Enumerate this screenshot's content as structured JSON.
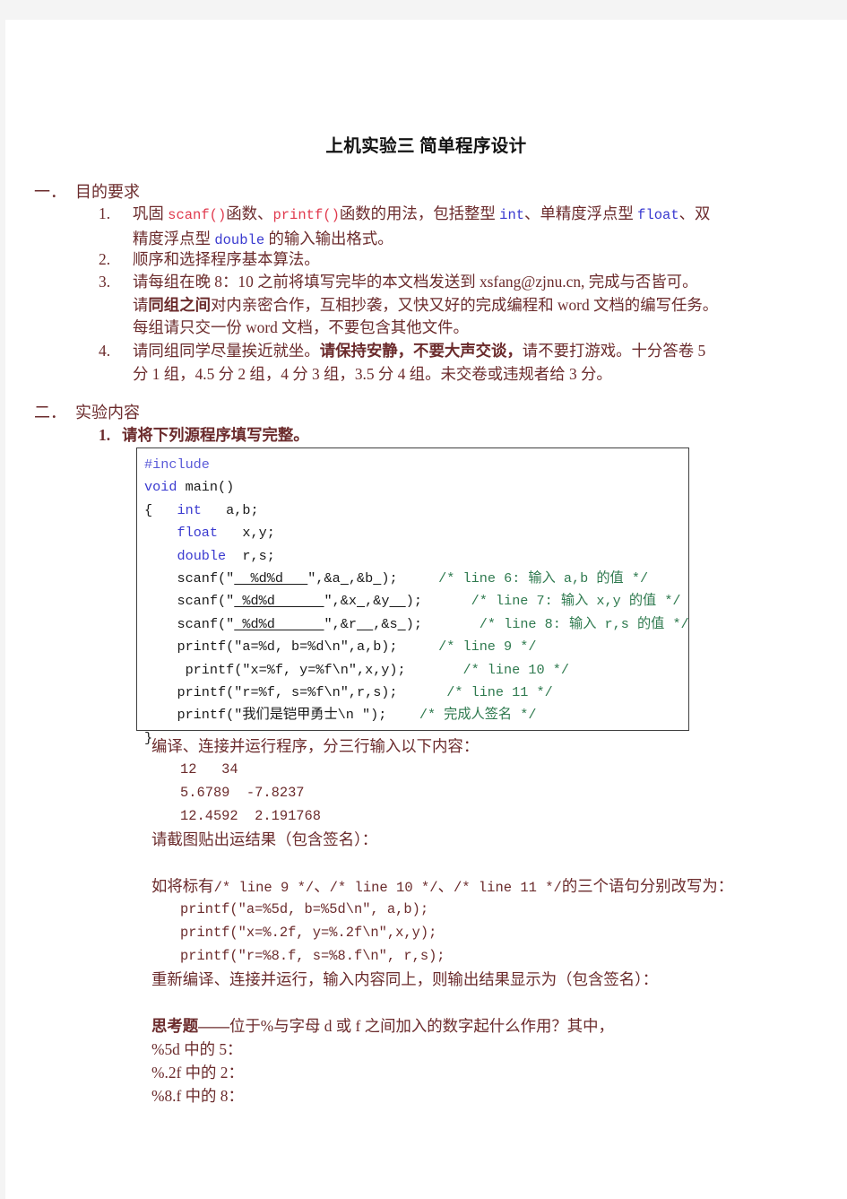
{
  "document": {
    "title": "上机实验三  简单程序设计",
    "colors": {
      "body_text": "#6b2b2c",
      "keyword_blue": "#3a3ad0",
      "function_red": "#e03a4e",
      "comment_green": "#2f7a4f",
      "title_black": "#121212",
      "code_border": "#3f3f3f",
      "page_background": "#f4f4f4"
    }
  },
  "section1": {
    "number": "一．",
    "heading": "目的要求",
    "items": [
      {
        "marker": "1.",
        "line1_a": "巩固 ",
        "line1_scanf": "scanf()",
        "line1_b": "函数、",
        "line1_printf": "printf()",
        "line1_c": "函数的用法，包括整型 ",
        "line1_int": "int",
        "line1_d": "、单精度浮点型 ",
        "line1_float": "float",
        "line1_e": "、双",
        "line2_a": "精度浮点型 ",
        "line2_double": "double",
        "line2_b": " 的输入输出格式。"
      },
      {
        "marker": "2.",
        "line1": "顺序和选择程序基本算法。"
      },
      {
        "marker": "3.",
        "line1": "请每组在晚 8：10 之前将填写完毕的本文档发送到 xsfang@zjnu.cn, 完成与否皆可。",
        "line2_a": "请",
        "line2_bold": "同组之间",
        "line2_b": "对内亲密合作，互相抄袭，又快又好的完成编程和 word 文档的编写任务。",
        "line3": "每组请只交一份 word 文档，不要包含其他文件。"
      },
      {
        "marker": "4.",
        "line1_a": "请同组同学尽量挨近就坐。",
        "line1_bold": "请保持安静，不要大声交谈，",
        "line1_b": "请不要打游戏。十分答卷 5",
        "line2": "分 1 组，4.5 分 2 组，4 分 3 组，3.5 分 4 组。未交卷或违规者给 3 分。"
      }
    ]
  },
  "section2": {
    "number": "二．",
    "heading": "实验内容",
    "item1": {
      "marker": "1.",
      "label": "请将下列源程序填写完整。"
    }
  },
  "code": {
    "lines": [
      {
        "id": "l1",
        "pp": "#include"
      },
      {
        "id": "l2",
        "kw": "void",
        "rest": " main()"
      },
      {
        "id": "l3",
        "pre": "{   ",
        "kw": "int",
        "rest": "   a,b;"
      },
      {
        "id": "l4",
        "pre": "    ",
        "kw": "float",
        "rest": "   x,y;"
      },
      {
        "id": "l5",
        "pre": "    ",
        "kw": "double",
        "rest": "  r,s;"
      },
      {
        "id": "l6",
        "pre": "    scanf(\"",
        "blank": "  %d%d   ",
        "mid": "\",&a",
        "blank2": " ",
        "mid2": ",&b",
        "blank3": " ",
        "post": ");",
        "gap": "     ",
        "cmt": "/* line 6: 输入 a,b 的值 */"
      },
      {
        "id": "l7",
        "pre": "    scanf(\"",
        "blank": " %d%d      ",
        "mid": "\",&x",
        "blank2": " ",
        "mid2": ",&y",
        "blank3": "  ",
        "post": ");",
        "gap": "      ",
        "cmt": "/* line 7: 输入 x,y 的值 */"
      },
      {
        "id": "l8",
        "pre": "    scanf(\"",
        "blank": " %d%d      ",
        "mid": "\",&r",
        "blank2": "  ",
        "mid2": ",&s",
        "blank3": " ",
        "post": ");",
        "gap": "       ",
        "cmt": "/* line 8: 输入 r,s 的值 */"
      },
      {
        "id": "l9",
        "pre": "    printf(\"a=%d, b=%d\\n\",a,b);",
        "gap": "     ",
        "cmt": "/* line 9 */"
      },
      {
        "id": "l10",
        "pre": "     printf(\"x=%f, y=%f\\n\",x,y);",
        "gap": "       ",
        "cmt": "/* line 10 */"
      },
      {
        "id": "l11",
        "pre": "    printf(\"r=%f, s=%f\\n\",r,s);",
        "gap": "      ",
        "cmt": "/* line 11 */"
      },
      {
        "id": "l12",
        "pre": "    printf(\"我们是铠甲勇士\\n \");",
        "gap": "    ",
        "cmt": "/* 完成人签名 */"
      },
      {
        "id": "l13",
        "pre": "}"
      }
    ]
  },
  "after_code": {
    "run_instruction": "编译、连接并运行程序，分三行输入以下内容：",
    "input_line1": "12   34",
    "input_line2": "5.6789  -7.8237",
    "input_line3": "12.4592  2.191768",
    "screenshot_request": "请截图贴出运结果（包含签名）："
  },
  "rewrite": {
    "lead_a": "如将标有",
    "lead_l9": "/* line 9 */",
    "lead_b": "、",
    "lead_l10": "/* line 10 */",
    "lead_c": "、",
    "lead_l11": "/* line 11 */",
    "lead_d": "的三个语句分别改写为：",
    "code_line1": "printf(\"a=%5d, b=%5d\\n\", a,b);",
    "code_line2": "printf(\"x=%.2f, y=%.2f\\n\",x,y);",
    "code_line3": "printf(\"r=%8.f, s=%8.f\\n\", r,s);",
    "result_request": "重新编译、连接并运行，输入内容同上，则输出结果显示为（包含签名）："
  },
  "thinking": {
    "label_bold": "思考题——",
    "label_rest": "位于%与字母 d 或 f 之间加入的数字起什么作用？其中，",
    "q1": "%5d 中的 5：",
    "q2": "%.2f 中的 2：",
    "q3": "%8.f 中的 8："
  }
}
